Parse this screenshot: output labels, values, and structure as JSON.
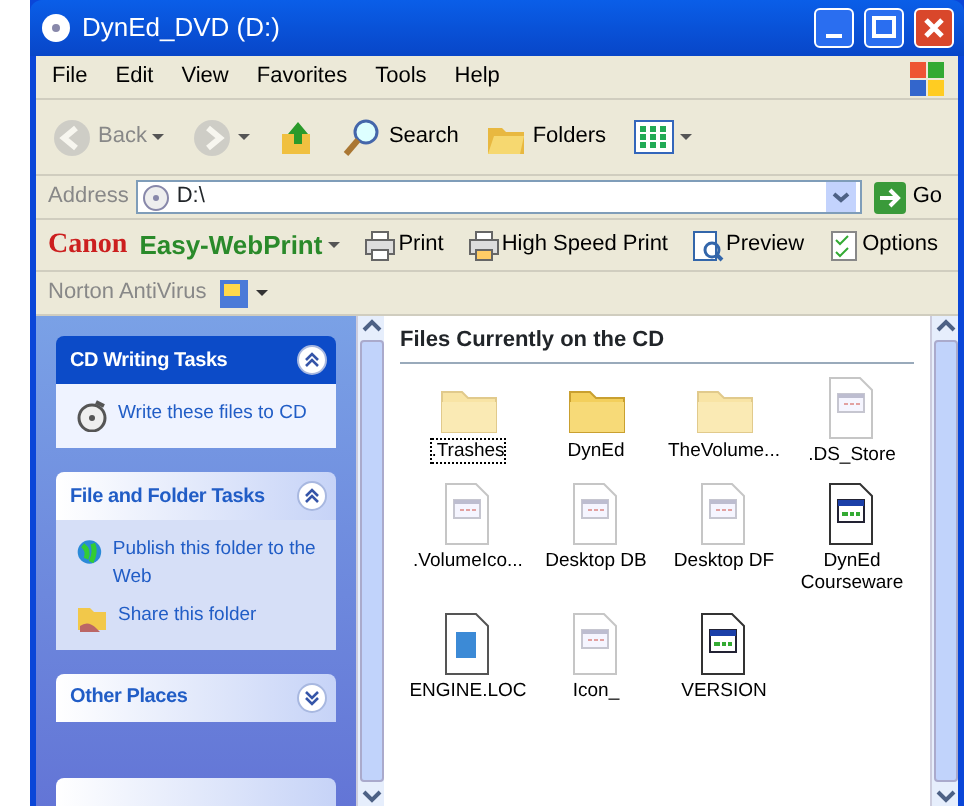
{
  "window": {
    "title": "DynEd_DVD (D:)"
  },
  "menu": [
    "File",
    "Edit",
    "View",
    "Favorites",
    "Tools",
    "Help"
  ],
  "toolbar": [
    {
      "kind": "back",
      "label": "Back",
      "disabled": true
    },
    {
      "kind": "forward",
      "disabled": true
    },
    {
      "kind": "up",
      "disabled": false
    },
    {
      "kind": "search",
      "label": "Search",
      "disabled": false
    },
    {
      "kind": "folders",
      "label": "Folders",
      "disabled": false
    },
    {
      "kind": "views",
      "disabled": false
    }
  ],
  "address": {
    "label": "Address",
    "value": "D:\\",
    "go": "Go"
  },
  "canon": {
    "brand": "Canon",
    "product": "Easy-WebPrint",
    "buttons": [
      {
        "kind": "print",
        "label": "Print"
      },
      {
        "kind": "hsprint",
        "label": "High Speed Print"
      },
      {
        "kind": "preview",
        "label": "Preview"
      },
      {
        "kind": "options",
        "label": "Options"
      }
    ]
  },
  "norton": {
    "label": "Norton AntiVirus"
  },
  "tasks": [
    {
      "title": "CD Writing Tasks",
      "special": true,
      "expanded": true,
      "items": [
        {
          "kind": "cd",
          "label": "Write these files to CD"
        }
      ]
    },
    {
      "title": "File and Folder Tasks",
      "special": false,
      "expanded": true,
      "items": [
        {
          "kind": "globe",
          "label": "Publish this folder to the Web"
        },
        {
          "kind": "share",
          "label": "Share this folder"
        }
      ]
    },
    {
      "title": "Other Places",
      "special": false,
      "expanded": false
    }
  ],
  "files": {
    "heading": "Files Currently on the CD",
    "items": [
      {
        "name": ".Trashes",
        "kind": "folder",
        "hidden": true,
        "selected": true
      },
      {
        "name": "DynEd",
        "kind": "folder",
        "hidden": false,
        "selected": false
      },
      {
        "name": "TheVolume...",
        "kind": "folder",
        "hidden": true,
        "selected": false
      },
      {
        "name": ".DS_Store",
        "kind": "doc",
        "hidden": true,
        "selected": false
      },
      {
        "name": ".VolumeIco...",
        "kind": "doc",
        "hidden": true,
        "selected": false
      },
      {
        "name": "Desktop DB",
        "kind": "doc",
        "hidden": true,
        "selected": false
      },
      {
        "name": "Desktop DF",
        "kind": "doc",
        "hidden": true,
        "selected": false
      },
      {
        "name": "DynEd Courseware",
        "kind": "app",
        "hidden": false,
        "selected": false
      },
      {
        "name": "ENGINE.LOC",
        "kind": "engine",
        "hidden": false,
        "selected": false
      },
      {
        "name": "Icon_",
        "kind": "doc",
        "hidden": true,
        "selected": false
      },
      {
        "name": "VERSION",
        "kind": "app",
        "hidden": false,
        "selected": false
      }
    ]
  }
}
